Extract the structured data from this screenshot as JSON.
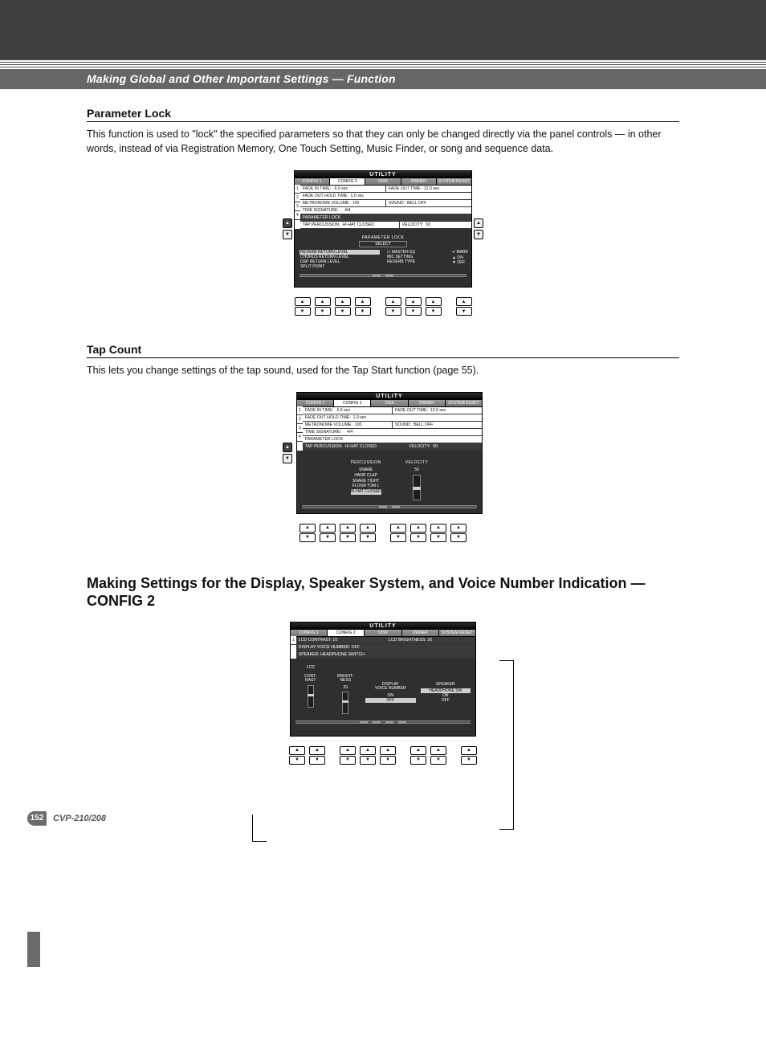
{
  "breadcrumb": "Making Global and Other Important Settings — Function",
  "section1": {
    "title": "Parameter Lock",
    "body": "This function is used to \"lock\" the specified parameters so that they can only be changed directly via the panel controls — in other words, instead of via Registration Memory, One Touch Setting, Music Finder, or song and sequence data."
  },
  "section2": {
    "title": "Tap Count",
    "body": "This lets you change settings of the tap sound, used for the Tap Start function (page 55)."
  },
  "section3": {
    "title": "Making Settings for the Display, Speaker System, and Voice Number Indication — CONFIG 2"
  },
  "utility": {
    "title": "UTILITY",
    "tabs": [
      "CONFIG 1",
      "CONFIG 2",
      "DISK",
      "OWNER",
      "SYSTEM RESET"
    ],
    "rows": {
      "r1a": "FADE IN TIME:   6.0 sec",
      "r1b": "FADE OUT TIME:  12.0 sec",
      "r1c": "FADE OUT HOLD TIME:  1.0 sec",
      "r2a": "METRONOME VOLUME:  100",
      "r2b": "SOUND:  BELL OFF",
      "r2c": "TIME SIGNATURE:     4/4",
      "r3": "PARAMETER LOCK",
      "r4a": "TAP PERCUSSION:  HI-HAT CLOSED",
      "r4b": "VELOCITY:  50"
    }
  },
  "paramlock": {
    "header": "PARAMETER LOCK",
    "select": "SELECT",
    "left": [
      "REVERB RETURN LEVEL",
      "CHORUS RETURN LEVEL",
      "DSP RETURN LEVEL",
      "SPLIT POINT"
    ],
    "right0": "MASTER EQ",
    "right": [
      "MIC SETTING",
      "REVERB TYPE"
    ],
    "marks": {
      "mark": "✔ MARK",
      "on": "▲ ON",
      "off": "▼ OFF"
    }
  },
  "tapcount": {
    "percTitle": "PERCUSSION",
    "velTitle": "VELOCITY",
    "velVal": "50",
    "list": [
      "SNARE",
      "HAND CLAP",
      "SNARE TIGHT",
      "FLOOR TOM L",
      "HI-HAT CLOSED"
    ]
  },
  "config2": {
    "rows": {
      "r1a": "LCD CONTRAST: 10",
      "r1b": "LCD BRIGHTNESS: 20",
      "r1c": "DISPLAY VOICE NUMBER: OFF",
      "r1d": "SPEAKER: HEADPHONE SWITCH"
    },
    "lcd": "LCD",
    "contrast": "CONT-\nRAST",
    "brightness": "BRIGHT-\nNESS",
    "contrastVal": "10",
    "brightnessVal": "20",
    "dvn": "DISPLAY\nVOICE NUMBER",
    "spk": "SPEAKER",
    "hpsw": "HEADPHONE SW",
    "on": "ON",
    "off": "OFF"
  },
  "footer": {
    "page": "152",
    "model": "CVP-210/208"
  }
}
